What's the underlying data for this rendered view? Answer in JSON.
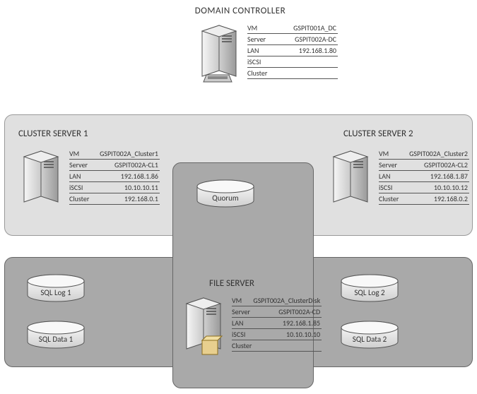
{
  "dc": {
    "title": "DOMAIN CONTROLLER",
    "props": {
      "vm": "GSPIT001A_DC",
      "server": "GSPIT002A-DC",
      "lan": "192.168.1.80",
      "iscsi": "",
      "cluster": ""
    }
  },
  "cs1": {
    "title": "CLUSTER SERVER 1",
    "props": {
      "vm": "GSPIT002A_Cluster1",
      "server": "GSPIT002A-CL1",
      "lan": "192.168.1.86",
      "iscsi": "10.10.10.11",
      "cluster": "192.168.0.1"
    }
  },
  "cs2": {
    "title": "CLUSTER SERVER 2",
    "props": {
      "vm": "GSPIT002A_Cluster2",
      "server": "GSPIT002A-CL2",
      "lan": "192.168.1.87",
      "iscsi": "10.10.10.12",
      "cluster": "192.168.0.2"
    }
  },
  "fs": {
    "title": "FILE SERVER",
    "props": {
      "vm": "GSPIT002A_ClusterDisk",
      "server": "GSPIT002A-CD",
      "lan": "192.168.1.85",
      "iscsi": "10.10.10.10",
      "cluster": ""
    }
  },
  "labels": {
    "vm": "VM",
    "server": "Server",
    "lan": "LAN",
    "iscsi": "iSCSI",
    "cluster": "Cluster"
  },
  "disks": {
    "quorum": "Quorum",
    "sqllog1": "SQL Log 1",
    "sqldata1": "SQL Data 1",
    "sqllog2": "SQL Log 2",
    "sqldata2": "SQL Data 2"
  }
}
